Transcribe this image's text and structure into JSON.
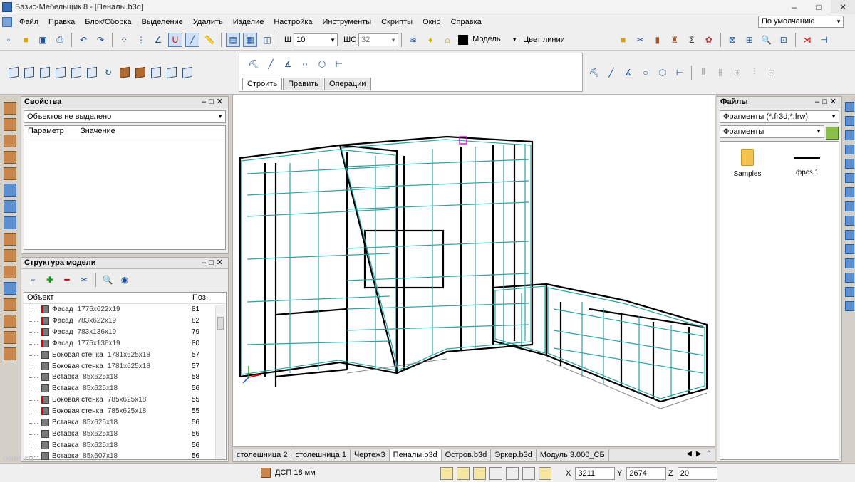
{
  "window": {
    "title": "Базис-Мебельщик 8 - [Пеналы.b3d]"
  },
  "menu": {
    "items": [
      "Файл",
      "Правка",
      "Блок/Сборка",
      "Выделение",
      "Удалить",
      "Изделие",
      "Настройка",
      "Инструменты",
      "Скрипты",
      "Окно",
      "Справка"
    ],
    "preset": "По умолчанию"
  },
  "toolbar": {
    "line_width_label": "Ш",
    "line_width_value": "10",
    "step_label": "ШС",
    "step_value": "32",
    "layer_value": "Модель",
    "line_color_label": "Цвет линии"
  },
  "build_panel": {
    "tabs": [
      "Строить",
      "Править",
      "Операции"
    ]
  },
  "properties": {
    "title": "Свойства",
    "selection": "Объектов не выделено",
    "col_param": "Параметр",
    "col_value": "Значение"
  },
  "structure": {
    "title": "Структура модели",
    "col_object": "Объект",
    "col_pos": "Поз.",
    "rows": [
      {
        "name": "Фасад",
        "dims": "1775x622x19",
        "pos": "81",
        "red": true
      },
      {
        "name": "Фасад",
        "dims": "783x622x19",
        "pos": "82",
        "red": true
      },
      {
        "name": "Фасад",
        "dims": "783x136x19",
        "pos": "79",
        "red": true
      },
      {
        "name": "Фасад",
        "dims": "1775x136x19",
        "pos": "80",
        "red": true
      },
      {
        "name": "Боковая стенка",
        "dims": "1781x625x18",
        "pos": "57",
        "red": false
      },
      {
        "name": "Боковая стенка",
        "dims": "1781x625x18",
        "pos": "57",
        "red": false
      },
      {
        "name": "Вставка",
        "dims": "85x625x18",
        "pos": "58",
        "red": false
      },
      {
        "name": "Вставка",
        "dims": "85x625x18",
        "pos": "56",
        "red": false
      },
      {
        "name": "Боковая стенка",
        "dims": "785x625x18",
        "pos": "55",
        "red": true
      },
      {
        "name": "Боковая стенка",
        "dims": "785x625x18",
        "pos": "55",
        "red": true
      },
      {
        "name": "Вставка",
        "dims": "85x625x18",
        "pos": "56",
        "red": false
      },
      {
        "name": "Вставка",
        "dims": "85x625x18",
        "pos": "56",
        "red": false
      },
      {
        "name": "Вставка",
        "dims": "85x625x18",
        "pos": "56",
        "red": false
      },
      {
        "name": "Вставка",
        "dims": "85x607x18",
        "pos": "56",
        "red": false
      }
    ]
  },
  "documents": {
    "tabs": [
      "столешница 2",
      "столешница 1",
      "Чертеж3",
      "Пеналы.b3d",
      "Остров.b3d",
      "Эркер.b3d",
      "Модуль 3.000_СБ"
    ],
    "active_index": 3
  },
  "files": {
    "title": "Файлы",
    "filter": "Фрагменты (*.fr3d;*.frw)",
    "folder": "Фрагменты",
    "items": [
      "Samples",
      "фрез.1"
    ]
  },
  "status": {
    "material": "ДСП 18 мм",
    "x_label": "X",
    "x": "3211",
    "y_label": "Y",
    "y": "2674",
    "z_label": "Z",
    "z": "20"
  },
  "watermark": "okid.ru",
  "colors": {
    "accent": "#2aa3a3",
    "background": "#ffffff"
  }
}
